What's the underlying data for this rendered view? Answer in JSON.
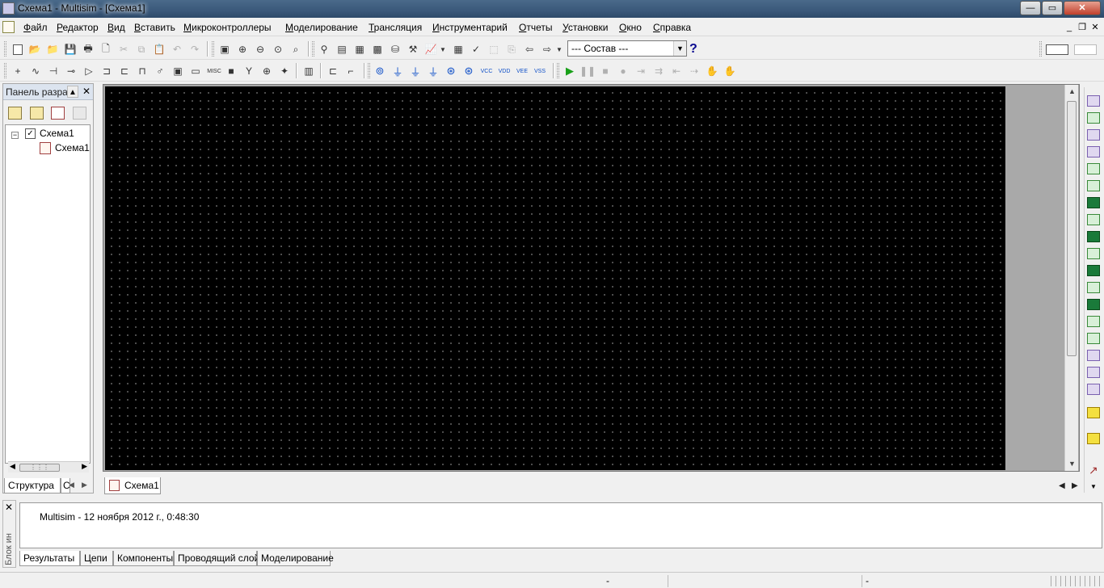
{
  "window": {
    "title": "Схема1 - Multisim - [Схема1]",
    "controls": {
      "minimize": "—",
      "maximize": "▭",
      "close": "✕"
    }
  },
  "menu": {
    "items": [
      "Файл",
      "Редактор",
      "Вид",
      "Вставить",
      "Микроконтроллеры",
      "Моделирование",
      "Трансляция",
      "Инструментарий",
      "Отчеты",
      "Установки",
      "Окно",
      "Справка"
    ],
    "mdi_controls": [
      "_",
      "❐",
      "✕"
    ]
  },
  "toolbar": {
    "variant_combo": "--- Состав ---",
    "help": "?"
  },
  "project_panel": {
    "title": "Панель разра",
    "tree": {
      "root": "Схема1",
      "child": "Схема1",
      "expander": "−",
      "check": "✓"
    },
    "tabs": [
      "Структура",
      "С"
    ]
  },
  "document": {
    "tab": "Схема1"
  },
  "output": {
    "side_label": "Блок ин",
    "close": "✕",
    "message": "Multisim  -  12 ноября 2012 г., 0:48:30",
    "tabs": [
      "Результаты",
      "Цепи",
      "Компоненты",
      "Проводящий слой",
      "Моделирование"
    ]
  },
  "status": {
    "cells": [
      "-",
      "-"
    ]
  },
  "colors": {
    "canvas": "#000000",
    "grid_dots": "#b0b0b0",
    "sheet_background": "#a9a9a9"
  }
}
